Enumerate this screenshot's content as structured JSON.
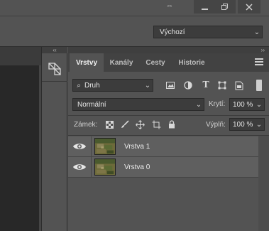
{
  "window": {
    "expand_icon": "expand-arrows-icon",
    "minimize_icon": "minimize-icon",
    "restore_icon": "restore-icon",
    "close_icon": "close-icon"
  },
  "options_bar": {
    "workspace": "Výchozí"
  },
  "panel": {
    "tabs": [
      {
        "label": "Vrstvy",
        "active": true
      },
      {
        "label": "Kanály",
        "active": false
      },
      {
        "label": "Cesty",
        "active": false
      },
      {
        "label": "Historie",
        "active": false
      }
    ],
    "filter": {
      "label": "Druh"
    },
    "blend_mode": "Normální",
    "opacity_label": "Krytí:",
    "opacity_value": "100 %",
    "lock_label": "Zámek:",
    "fill_label": "Výplň:",
    "fill_value": "100 %",
    "layers": [
      {
        "name": "Vrstva 1",
        "visible": true
      },
      {
        "name": "Vrstva 0",
        "visible": true
      }
    ]
  },
  "colors": {
    "panel_bg": "#535353",
    "layer_row": "#5f5f5f",
    "canvas": "#282828"
  }
}
